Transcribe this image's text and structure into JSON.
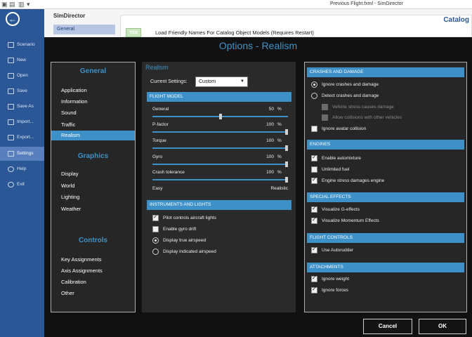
{
  "window": {
    "title": "Previous Flight.fxml - SimDirector"
  },
  "sidebar": {
    "items": [
      {
        "label": "Scenario"
      },
      {
        "label": "New"
      },
      {
        "label": "Open"
      },
      {
        "label": "Save"
      },
      {
        "label": "Save As"
      },
      {
        "label": "Import..."
      },
      {
        "label": "Export..."
      },
      {
        "label": "Settings"
      },
      {
        "label": "Help"
      },
      {
        "label": "Exit"
      }
    ]
  },
  "background": {
    "app_name": "SimDirector",
    "nav_general": "General",
    "yes_badge": "YES",
    "option_text": "Load Friendly Names For Catalog Object Models (Requires Restart)",
    "catalog": "Catalog"
  },
  "dialog": {
    "title": "Options - Realism",
    "categories": {
      "general_header": "General",
      "general_items": [
        "Application",
        "Information",
        "Sound",
        "Traffic",
        "Realism"
      ],
      "graphics_header": "Graphics",
      "graphics_items": [
        "Display",
        "World",
        "Lighting",
        "Weather"
      ],
      "controls_header": "Controls",
      "controls_items": [
        "Key Assignments",
        "Axis Assignments",
        "Calibration",
        "Other"
      ]
    },
    "realism": {
      "header": "Realism",
      "current_settings_label": "Current Settings:",
      "current_settings_value": "Custom",
      "flight_model_header": "FLIGHT MODEL",
      "sliders": [
        {
          "label": "General",
          "value": "50",
          "unit": "%"
        },
        {
          "label": "P-factor",
          "value": "100",
          "unit": "%"
        },
        {
          "label": "Torque",
          "value": "100",
          "unit": "%"
        },
        {
          "label": "Gyro",
          "value": "100",
          "unit": "%"
        },
        {
          "label": "Crash tolerance",
          "value": "100",
          "unit": "%"
        }
      ],
      "easy": "Easy",
      "realistic": "Realistic",
      "instruments_header": "INSTRUMENTS AND LIGHTS",
      "pilot_controls": "Pilot controls aircraft lights",
      "gyro_drift": "Enable gyro drift",
      "true_airspeed": "Display true airspeed",
      "indicated_airspeed": "Display indicated airspeed"
    },
    "right": {
      "crashes_header": "CRASHES AND DAMAGE",
      "ignore_crashes": "Ignore crashes and damage",
      "detect_crashes": "Detect crashes and damage",
      "vehicle_stress": "Vehicle stress causes damage",
      "allow_collisions": "Allow collisions with other vehicles",
      "ignore_avatar": "Ignore avatar collision",
      "engines_header": "ENGINES",
      "automixture": "Enable automixture",
      "unlimited_fuel": "Unlimited fuel",
      "engine_stress": "Engine stress damages engine",
      "special_header": "SPECIAL EFFECTS",
      "g_effects": "Visualize G-effects",
      "momentum_effects": "Visualize Momentum Effects",
      "flight_controls_header": "FLIGHT CONTROLS",
      "autorudder": "Use Autorudder",
      "attachments_header": "ATTACHMENTS",
      "ignore_weight": "Ignore weight",
      "ignore_forces": "Ignore forces"
    },
    "cancel_label": "Cancel",
    "ok_label": "OK"
  },
  "colors": {
    "accent": "#3e91c8",
    "sidebar": "#2b5797",
    "dialog_bg": "#111111"
  }
}
